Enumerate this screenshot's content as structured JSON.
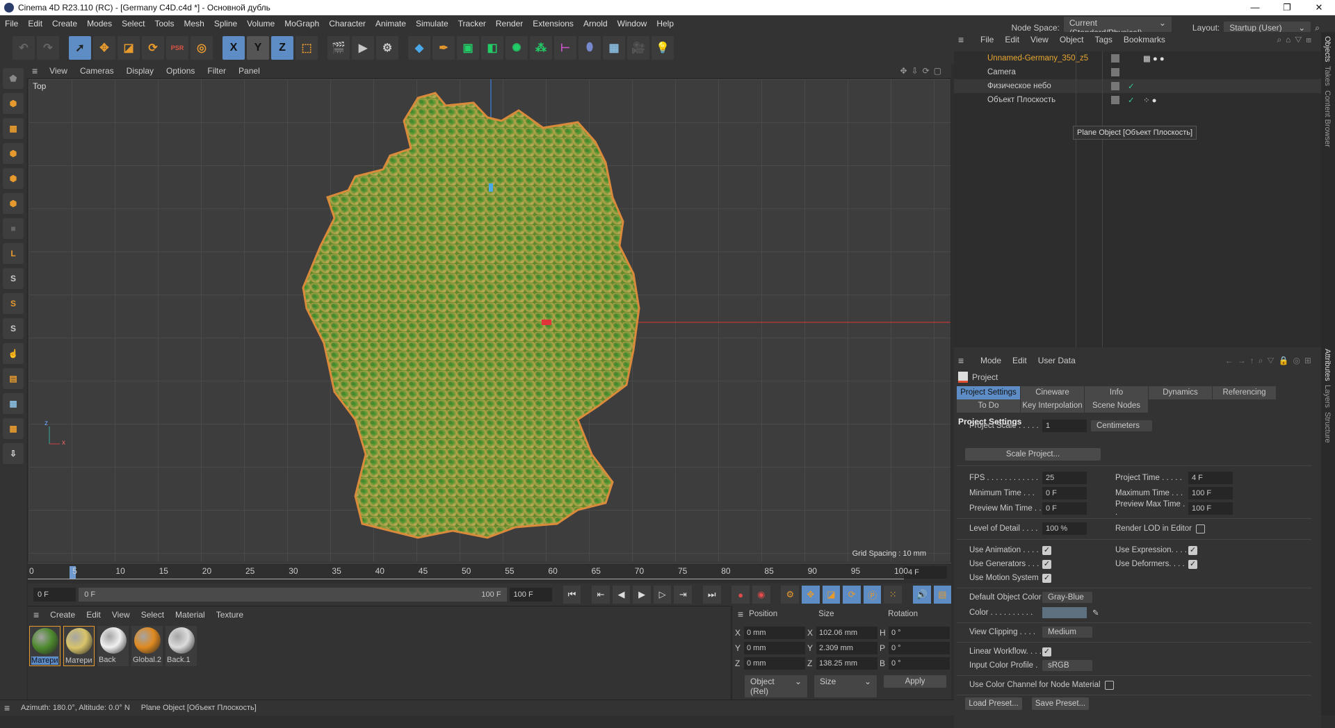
{
  "window": {
    "title": "Cinema 4D R23.110 (RC) - [Germany C4D.c4d *] - Основной дубль",
    "minimize": "—",
    "maximize": "❐",
    "close": "✕"
  },
  "menu": [
    "File",
    "Edit",
    "Create",
    "Modes",
    "Select",
    "Tools",
    "Mesh",
    "Spline",
    "Volume",
    "MoGraph",
    "Character",
    "Animate",
    "Simulate",
    "Tracker",
    "Render",
    "Extensions",
    "Arnold",
    "Window",
    "Help"
  ],
  "node_space": {
    "label": "Node Space:",
    "value": "Current (Standard/Physical)"
  },
  "layout": {
    "label": "Layout:",
    "value": "Startup (User)"
  },
  "toolbar": {
    "x": "X",
    "y": "Y",
    "z": "Z",
    "psr": "PSR"
  },
  "viewport": {
    "menu": [
      "View",
      "Cameras",
      "Display",
      "Options",
      "Filter",
      "Panel"
    ],
    "view_name": "Top",
    "grid_spacing": "Grid Spacing : 10 mm",
    "axis_x": "x",
    "axis_z": "z"
  },
  "timeline": {
    "ticks": [
      "0",
      "5",
      "10",
      "15",
      "20",
      "25",
      "30",
      "35",
      "40",
      "45",
      "50",
      "55",
      "60",
      "65",
      "70",
      "75",
      "80",
      "85",
      "90",
      "95",
      "100"
    ],
    "current": "4",
    "current_frame_field": "4 F",
    "start_field": "0 F",
    "range_start": "0 F",
    "range_end": "100 F",
    "end_field": "100 F"
  },
  "material_manager": {
    "menu": [
      "Create",
      "Edit",
      "View",
      "Select",
      "Material",
      "Texture"
    ],
    "materials": [
      {
        "name": "Матери",
        "color": "#4e8a2e"
      },
      {
        "name": "Матери",
        "color": "#d8c46a"
      },
      {
        "name": "Back",
        "color": "#f0f0f0"
      },
      {
        "name": "Global.2",
        "color": "#e08a20"
      },
      {
        "name": "Back.1",
        "color": "#dcdcdc"
      }
    ]
  },
  "coordinates": {
    "headers": [
      "Position",
      "Size",
      "Rotation"
    ],
    "rows": [
      {
        "a": "X",
        "pos": "0 mm",
        "b": "X",
        "size": "102.06 mm",
        "c": "H",
        "rot": "0 °"
      },
      {
        "a": "Y",
        "pos": "0 mm",
        "b": "Y",
        "size": "2.309 mm",
        "c": "P",
        "rot": "0 °"
      },
      {
        "a": "Z",
        "pos": "0 mm",
        "b": "Z",
        "size": "138.25 mm",
        "c": "B",
        "rot": "0 °"
      }
    ],
    "mode": "Object (Rel)",
    "size_mode": "Size",
    "apply": "Apply"
  },
  "status": {
    "azimuth": "Azimuth: 180.0°, Altitude: 0.0°  N",
    "selection": "Plane Object [Объект Плоскость]"
  },
  "object_manager": {
    "menu": [
      "File",
      "Edit",
      "View",
      "Object",
      "Tags",
      "Bookmarks"
    ],
    "objects": [
      {
        "name": "Unnamed-Germany_350_z5",
        "color": "#e8a830"
      },
      {
        "name": "Camera",
        "color": "#cccccc"
      },
      {
        "name": "Физическое небо",
        "color": "#cccccc"
      },
      {
        "name": "Объект Плоскость",
        "color": "#cccccc"
      }
    ],
    "tooltip": "Plane Object [Объект Плоскость]"
  },
  "side_tabs": [
    "Objects",
    "Takes",
    "Content Browser",
    "Attributes",
    "Layers",
    "Structure"
  ],
  "attributes": {
    "menu": [
      "Mode",
      "Edit",
      "User Data"
    ],
    "object": "Project",
    "tabs": [
      "Project Settings",
      "Cineware",
      "Info",
      "Dynamics",
      "Referencing",
      "To Do",
      "Key Interpolation",
      "Scene Nodes"
    ],
    "section": "Project Settings",
    "project_scale": {
      "label": "Project Scale . . . . .",
      "value": "1",
      "unit": "Centimeters"
    },
    "scale_project": "Scale Project...",
    "fps": {
      "label": "FPS . . . . . . . . . . . .",
      "value": "25"
    },
    "project_time": {
      "label": "Project Time . . . . .",
      "value": "4 F"
    },
    "min_time": {
      "label": "Minimum Time . . .",
      "value": "0 F"
    },
    "max_time": {
      "label": "Maximum Time . . .",
      "value": "100 F"
    },
    "prev_min": {
      "label": "Preview Min Time . .",
      "value": "0 F"
    },
    "prev_max": {
      "label": "Preview Max Time . .",
      "value": "100 F"
    },
    "lod": {
      "label": "Level of Detail . . . .",
      "value": "100 %"
    },
    "render_lod": "Render LOD in Editor",
    "use_animation": "Use Animation . . . .",
    "use_expression": "Use Expression. . . .",
    "use_generators": "Use Generators . . .",
    "use_deformers": "Use Deformers. . . .",
    "use_motion": "Use Motion System",
    "default_color": {
      "label": "Default Object Color",
      "value": "Gray-Blue"
    },
    "color": {
      "label": "Color . . . . . . . . . .",
      "value": "#5e7180"
    },
    "view_clipping": {
      "label": "View Clipping . . . .",
      "value": "Medium"
    },
    "linear_workflow": "Linear Workflow. . . .",
    "input_profile": {
      "label": "Input Color Profile .",
      "value": "sRGB"
    },
    "node_material": "Use Color Channel for Node Material",
    "load_preset": "Load Preset...",
    "save_preset": "Save Preset..."
  },
  "colors": {
    "accent": "#5d8dc4",
    "orange": "#e69a2e"
  }
}
